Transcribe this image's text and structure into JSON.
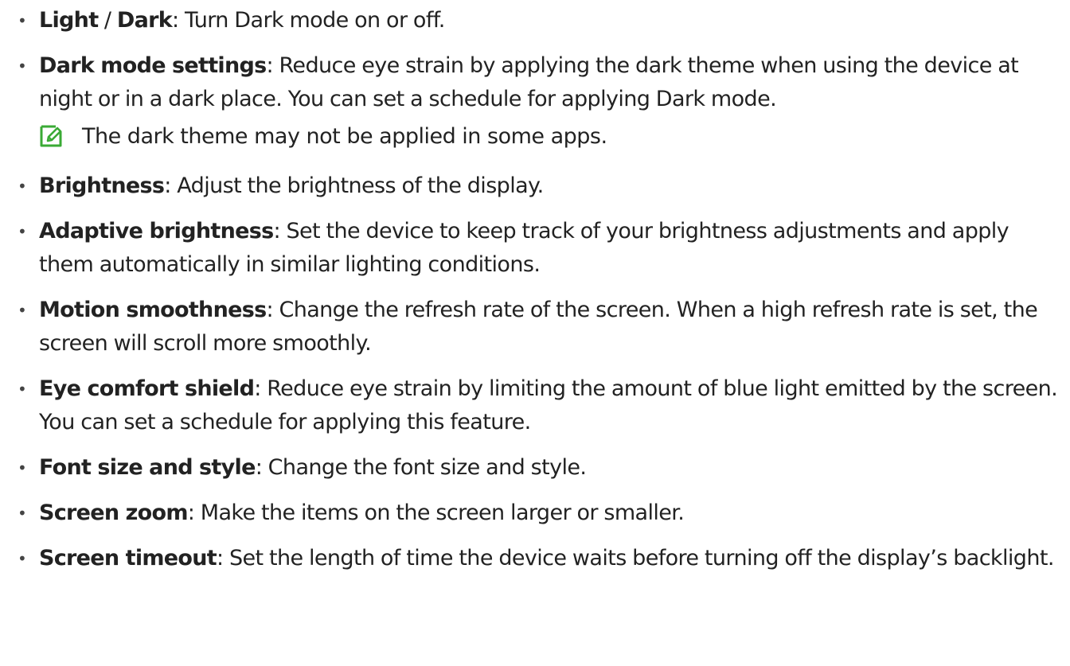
{
  "items": [
    {
      "term": "Light",
      "sep": " / ",
      "term2": "Dark",
      "desc": ": Turn Dark mode on or off."
    },
    {
      "term": "Dark mode settings",
      "desc": ": Reduce eye strain by applying the dark theme when using the device at night or in a dark place. You can set a schedule for applying Dark mode."
    },
    {
      "term": "Brightness",
      "desc": ": Adjust the brightness of the display."
    },
    {
      "term": "Adaptive brightness",
      "desc": ": Set the device to keep track of your brightness adjustments and apply them automatically in similar lighting conditions."
    },
    {
      "term": "Motion smoothness",
      "desc": ": Change the refresh rate of the screen. When a high refresh rate is set, the screen will scroll more smoothly."
    },
    {
      "term": "Eye comfort shield",
      "desc": ": Reduce eye strain by limiting the amount of blue light emitted by the screen. You can set a schedule for applying this feature."
    },
    {
      "term": "Font size and style",
      "desc": ": Change the font size and style."
    },
    {
      "term": "Screen zoom",
      "desc": ": Make the items on the screen larger or smaller."
    },
    {
      "term": "Screen timeout",
      "desc": ": Set the length of time the device waits before turning off the display’s backlight."
    }
  ],
  "note": {
    "icon": "note-pencil-icon",
    "icon_color": "#3aaa35",
    "text": "The dark theme may not be applied in some apps."
  },
  "bullet_char": "•"
}
